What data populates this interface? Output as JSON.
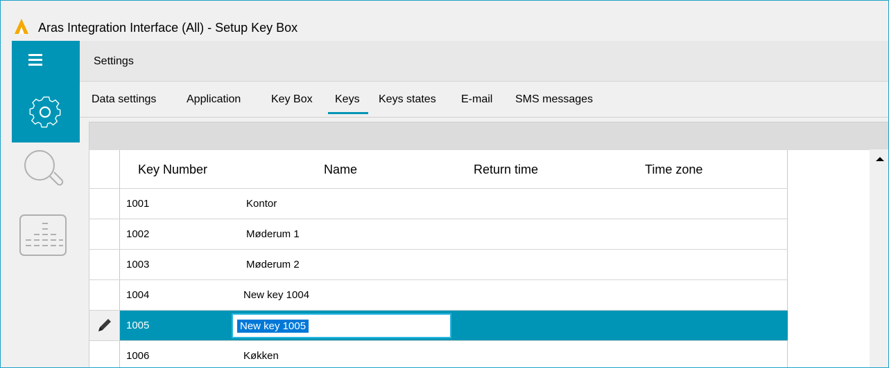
{
  "window": {
    "title": "Aras Integration Interface (All) - Setup Key Box",
    "accent_color": "#0095b6",
    "logo_color": "#f5a800"
  },
  "sidebar": {
    "items": [
      {
        "icon": "hamburger-menu-icon"
      },
      {
        "icon": "gear-icon",
        "selected": true
      },
      {
        "icon": "search-icon"
      },
      {
        "icon": "report-icon"
      }
    ]
  },
  "breadcrumb": "Settings",
  "tabs": [
    {
      "label": "Data settings"
    },
    {
      "label": "Application"
    },
    {
      "label": "Key Box"
    },
    {
      "label": "Keys",
      "active": true
    },
    {
      "label": "Keys states"
    },
    {
      "label": "E-mail"
    },
    {
      "label": "SMS messages"
    }
  ],
  "grid": {
    "columns": [
      "Key Number",
      "Name",
      "Return time",
      "Time zone"
    ],
    "rows": [
      {
        "number": "1001",
        "name": "Kontor",
        "return_time": "",
        "time_zone": ""
      },
      {
        "number": "1002",
        "name": "Møderum 1",
        "return_time": "",
        "time_zone": ""
      },
      {
        "number": "1003",
        "name": "Møderum 2",
        "return_time": "",
        "time_zone": ""
      },
      {
        "number": "1004",
        "name": "New key 1004",
        "return_time": "",
        "time_zone": ""
      },
      {
        "number": "1005",
        "name": "New key 1005",
        "return_time": "",
        "time_zone": "",
        "selected": true,
        "editing": true
      },
      {
        "number": "1006",
        "name": "Køkken",
        "return_time": "",
        "time_zone": ""
      }
    ],
    "selected_row_color": "#0095b6"
  }
}
